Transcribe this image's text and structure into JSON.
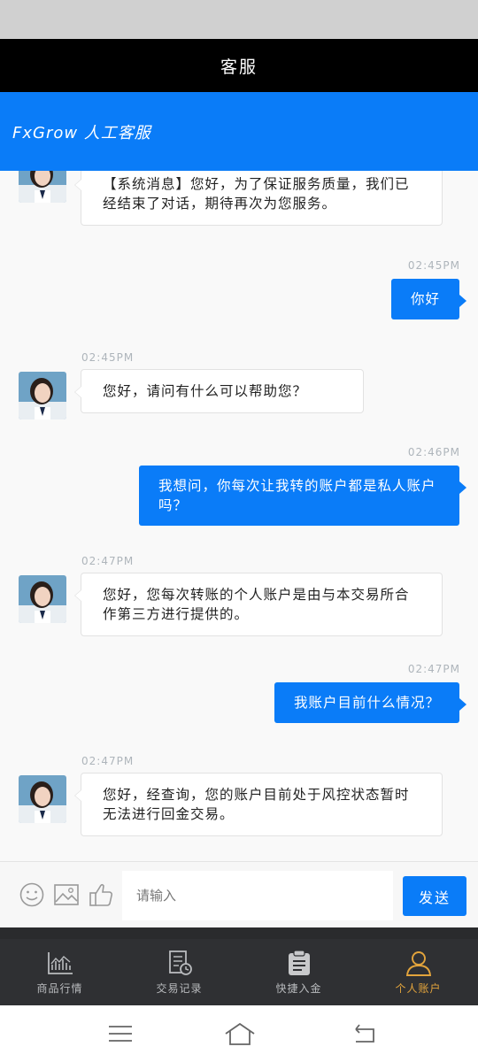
{
  "title_bar": {
    "title": "客服"
  },
  "chat_header": {
    "title": "FxGrow 人工客服"
  },
  "messages": [
    {
      "side": "left",
      "text": "【系统消息】您好，为了保证服务质量，我们已经结束了对话，期待再次为您服务。"
    },
    {
      "side": "right",
      "time": "02:45PM",
      "text": "你好"
    },
    {
      "side": "left",
      "time": "02:45PM",
      "text": "您好，请问有什么可以帮助您？"
    },
    {
      "side": "right",
      "time": "02:46PM",
      "text": "我想问，你每次让我转的账户都是私人账户吗？"
    },
    {
      "side": "left",
      "time": "02:47PM",
      "text": "您好，您每次转账的个人账户是由与本交易所合作第三方进行提供的。"
    },
    {
      "side": "right",
      "time": "02:47PM",
      "text": "我账户目前什么情况？"
    },
    {
      "side": "left",
      "time": "02:47PM",
      "text": "您好，经查询，您的账户目前处于风控状态暂时无法进行回金交易。"
    }
  ],
  "input": {
    "placeholder": "请输入",
    "send_label": "发送"
  },
  "icons": [
    "smiley-icon",
    "image-icon",
    "thumbs-up-icon"
  ],
  "bottom_nav": [
    {
      "label": "商品行情",
      "icon": "chart-icon",
      "active": false
    },
    {
      "label": "交易记录",
      "icon": "record-icon",
      "active": false
    },
    {
      "label": "快捷入金",
      "icon": "clipboard-icon",
      "active": false
    },
    {
      "label": "个人账户",
      "icon": "user-icon",
      "active": true
    }
  ],
  "colors": {
    "accent": "#0a7cf8",
    "nav_active": "#e3a43c",
    "nav_bg": "#2f3033"
  }
}
